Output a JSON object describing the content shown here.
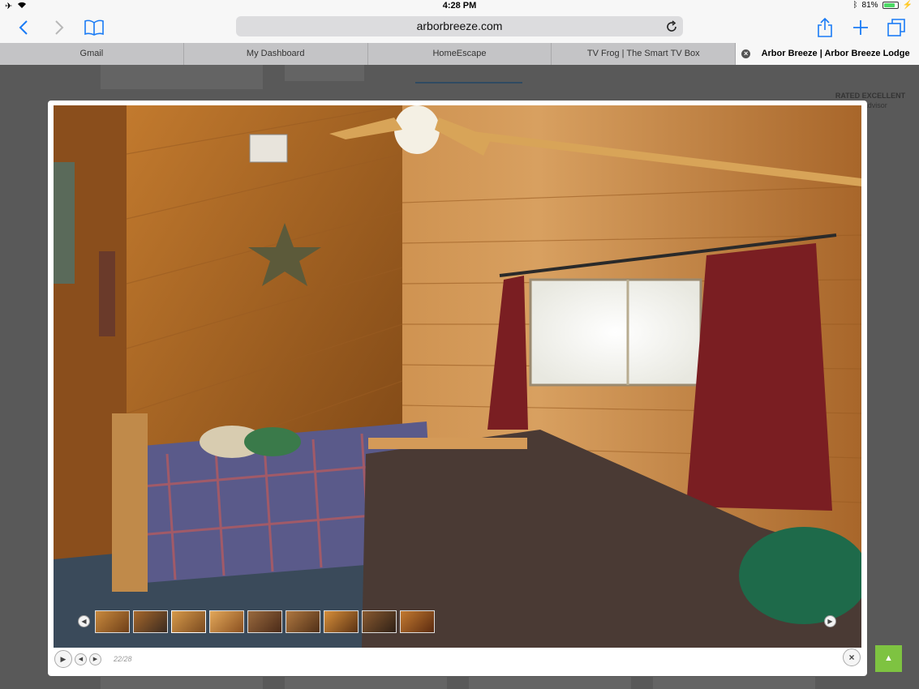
{
  "status": {
    "time": "4:28 PM",
    "battery_text": "81%",
    "battery_level": 0.81
  },
  "browser": {
    "url": "arborbreeze.com",
    "tabs": [
      {
        "label": "Gmail"
      },
      {
        "label": "My Dashboard"
      },
      {
        "label": "HomeEscape"
      },
      {
        "label": "TV Frog | The Smart TV Box"
      },
      {
        "label": "Arbor Breeze | Arbor Breeze Lodge"
      }
    ]
  },
  "page": {
    "badge_line1": "RATED EXCELLENT",
    "badge_line2": "tripadvisor"
  },
  "lightbox": {
    "counter": "22/28",
    "thumbnail_count": 9
  },
  "colors": {
    "accent": "#1a7bf5",
    "scroll_top": "#7ec341"
  },
  "icons": {
    "back": "chevron-left-icon",
    "forward": "chevron-right-icon",
    "bookmarks": "book-icon",
    "share": "share-icon",
    "new_tab": "plus-icon",
    "tabs": "tabs-icon",
    "reload": "reload-icon"
  }
}
